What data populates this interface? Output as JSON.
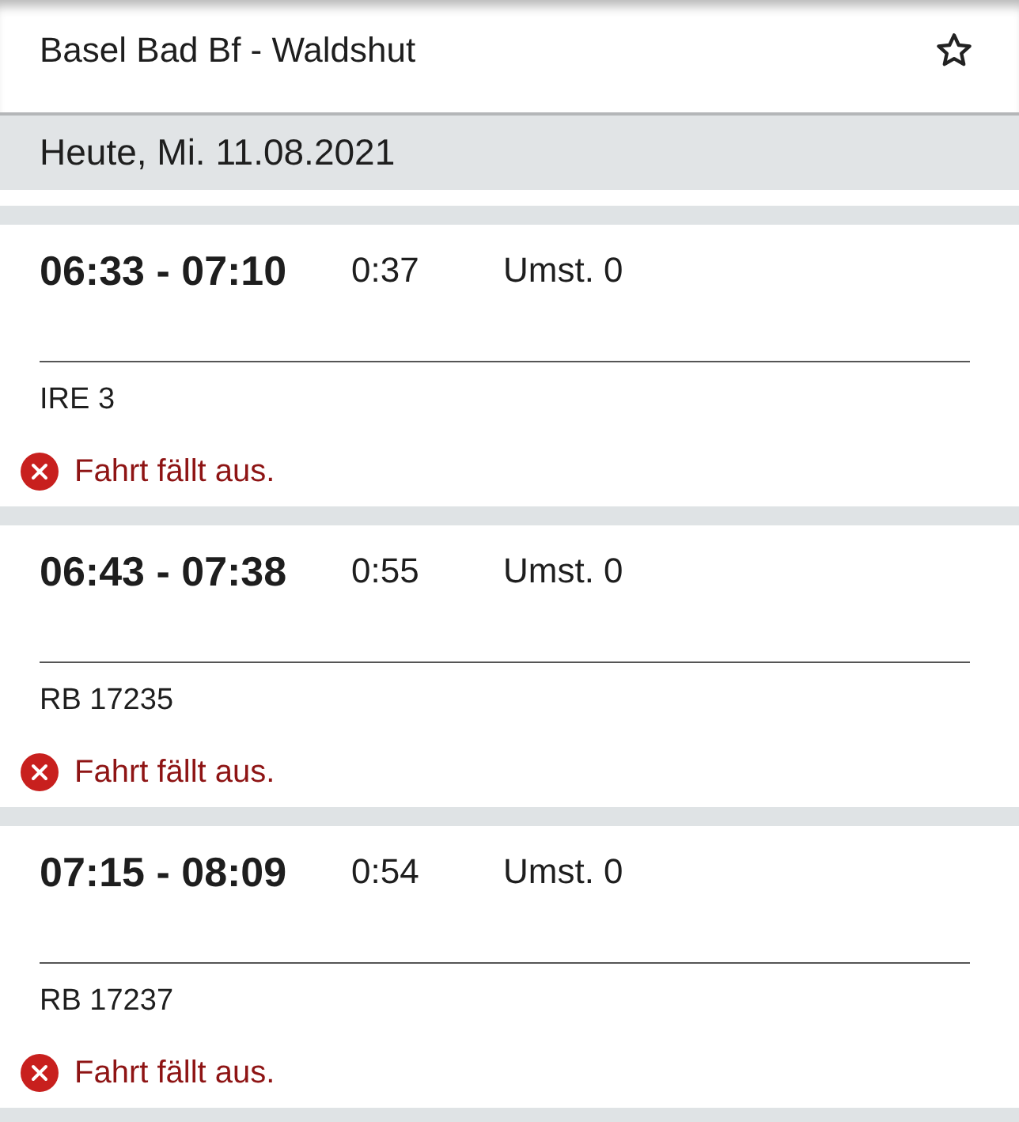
{
  "header": {
    "title": "Basel Bad Bf - Waldshut",
    "favorite": false
  },
  "date": "Heute, Mi. 11.08.2021",
  "connections": [
    {
      "times": "06:33 - 07:10",
      "duration": "0:37",
      "transfers": "Umst. 0",
      "train": "IRE 3",
      "notice": {
        "kind": "error",
        "text": "Fahrt fällt aus."
      }
    },
    {
      "times": "06:43 - 07:38",
      "duration": "0:55",
      "transfers": "Umst. 0",
      "train": "RB 17235",
      "notice": {
        "kind": "error",
        "text": "Fahrt fällt aus."
      }
    },
    {
      "times": "07:15 - 08:09",
      "duration": "0:54",
      "transfers": "Umst. 0",
      "train": "RB 17237",
      "notice": {
        "kind": "error",
        "text": "Fahrt fällt aus."
      }
    }
  ]
}
